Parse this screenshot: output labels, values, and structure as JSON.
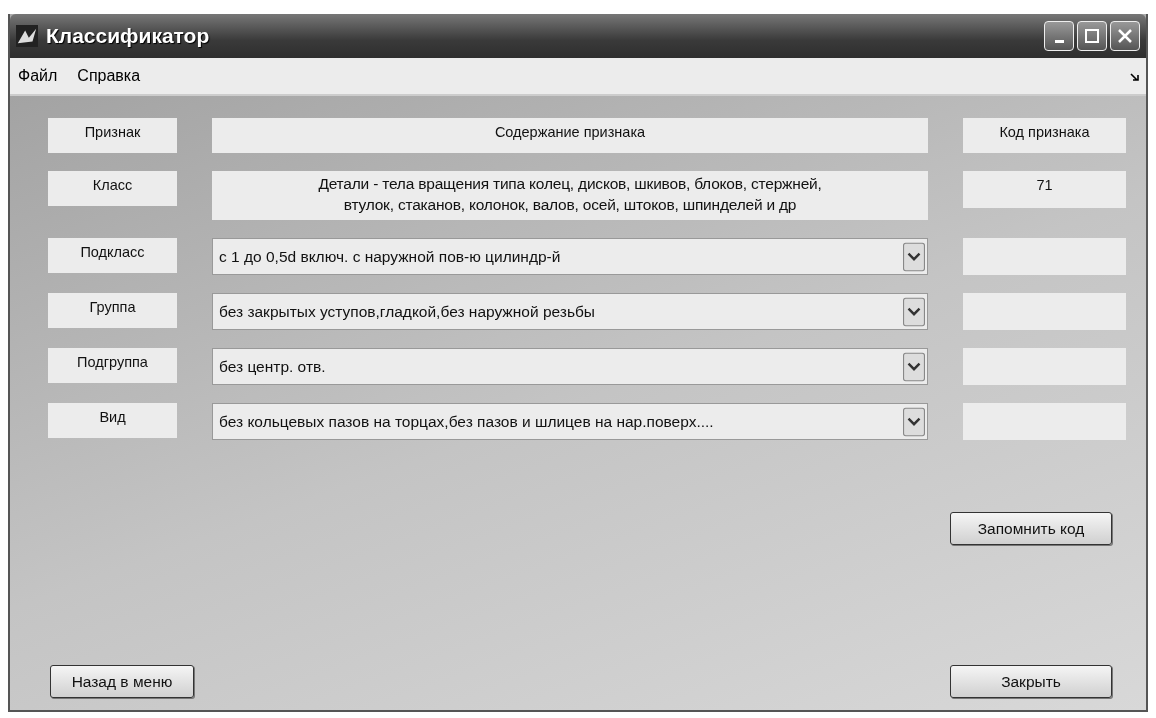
{
  "window": {
    "title": "Классификатор"
  },
  "menu": [
    {
      "label": "Файл"
    },
    {
      "label": "Справка"
    }
  ],
  "headers": {
    "feature": "Признак",
    "content": "Содержание признака",
    "code": "Код признака"
  },
  "rows": [
    {
      "label": "Класс",
      "kind": "text",
      "lines": [
        "Детали - тела вращения типа колец, дисков, шкивов, блоков, стержней,",
        "втулок, стаканов, колонок, валов, осей, штоков, шпинделей и др"
      ],
      "code": "71"
    },
    {
      "label": "Подкласс",
      "kind": "dropdown",
      "value": "с 1 до 0,5d включ. с наружной пов-ю цилиндр-й"
    },
    {
      "label": "Группа",
      "kind": "dropdown",
      "value": "без закрытых уступов,гладкой,без наружной резьбы"
    },
    {
      "label": "Подгруппа",
      "kind": "dropdown",
      "value": "без центр. отв."
    },
    {
      "label": "Вид",
      "kind": "dropdown",
      "value": "без кольцевых пазов на торцах,без пазов и шлицев на нар.поверх...."
    }
  ],
  "buttons": {
    "remember": "Запомнить код",
    "back": "Назад в меню",
    "close": "Закрыть"
  }
}
